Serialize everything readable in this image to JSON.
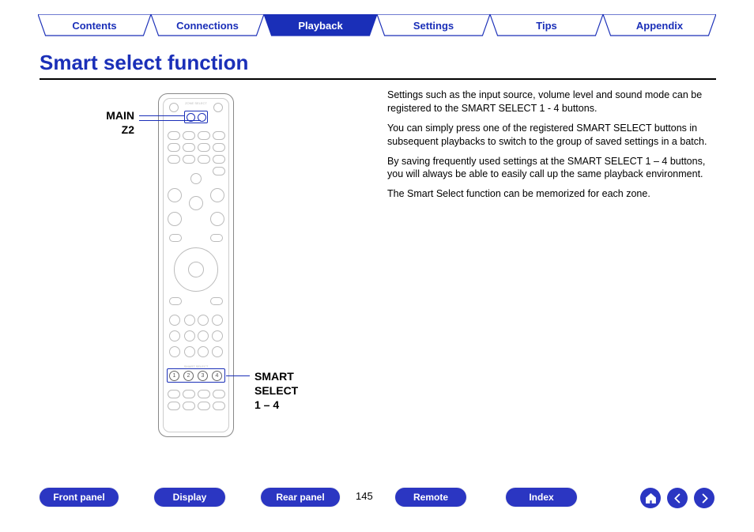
{
  "topTabs": {
    "items": [
      {
        "label": "Contents",
        "active": false
      },
      {
        "label": "Connections",
        "active": false
      },
      {
        "label": "Playback",
        "active": true
      },
      {
        "label": "Settings",
        "active": false
      },
      {
        "label": "Tips",
        "active": false
      },
      {
        "label": "Appendix",
        "active": false
      }
    ]
  },
  "title": "Smart select function",
  "remote": {
    "callout_main": "MAIN",
    "callout_z2": "Z2",
    "callout_smart_line1": "SMART",
    "callout_smart_line2": "SELECT",
    "callout_smart_line3": "1 – 4",
    "zone_select_label": "ZONE SELECT",
    "smart_select_band_label": "SMART SELECT",
    "smart_numbers": [
      "1",
      "2",
      "3",
      "4"
    ]
  },
  "description": {
    "p1": "Settings such as the input source, volume level and sound mode can be registered to the SMART SELECT 1 - 4 buttons.",
    "p2": "You can simply press one of the registered SMART SELECT buttons in subsequent playbacks to switch to the group of saved settings in a batch.",
    "p3": "By saving frequently used settings at the SMART SELECT 1 – 4 buttons, you will always be able to easily call up the same playback environment.",
    "p4": "The Smart Select function can be memorized for each zone."
  },
  "bottomNav": {
    "front_panel": "Front panel",
    "display": "Display",
    "rear_panel": "Rear panel",
    "page": "145",
    "remote": "Remote",
    "index": "Index"
  },
  "icons": {
    "home": "home-icon",
    "back": "back-icon",
    "forward": "forward-icon"
  }
}
